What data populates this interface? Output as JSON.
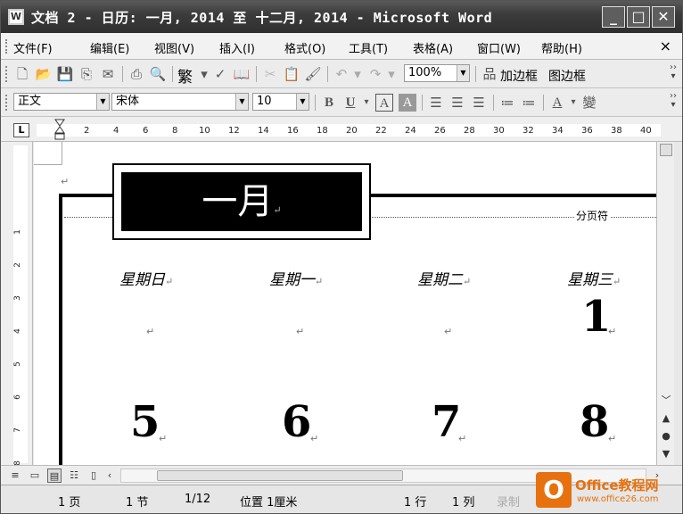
{
  "window": {
    "title": "文档 2 - 日历: 一月, 2014 至 十二月, 2014 - Microsoft Word",
    "icon_glyph": "W"
  },
  "menu": {
    "items": [
      "文件(F)",
      "编辑(E)",
      "视图(V)",
      "插入(I)",
      "格式(O)",
      "工具(T)",
      "表格(A)",
      "窗口(W)",
      "帮助(H)"
    ],
    "close_doc": "×"
  },
  "standard_toolbar": {
    "font_glyph": "繁",
    "zoom": "100%",
    "add_border": "加边框",
    "picture_border": "图边框"
  },
  "format_toolbar": {
    "style": "正文",
    "font": "宋体",
    "size": "10",
    "bold": "B",
    "underline": "U",
    "char_border": "A",
    "char_shading": "A",
    "font_color": "A",
    "phonetic": "變"
  },
  "ruler": {
    "corner": "L",
    "ticks": [
      "2",
      "4",
      "6",
      "8",
      "10",
      "12",
      "14",
      "16",
      "18",
      "20",
      "22",
      "24",
      "26",
      "28",
      "30",
      "32",
      "34",
      "36",
      "38",
      "40"
    ]
  },
  "vruler": {
    "numbers": [
      "1",
      "2",
      "3",
      "4",
      "5",
      "6",
      "7",
      "8"
    ]
  },
  "document": {
    "month": "一月",
    "page_break_label": "分页符",
    "paragraph_mark": "↵",
    "weekdays": [
      "星期日",
      "星期一",
      "星期二",
      "星期三"
    ],
    "first_row_days": [
      "",
      "",
      "",
      "1"
    ],
    "second_row_days": [
      "5",
      "6",
      "7",
      "8"
    ]
  },
  "status": {
    "page": "1 页",
    "section": "1 节",
    "page_of": "1/12",
    "position": "位置 1厘米",
    "line": "1 行",
    "column": "1 列",
    "record": "录制"
  },
  "watermark": {
    "logo": "O",
    "site_name": "Office教程网",
    "url": "www.office26.com"
  }
}
